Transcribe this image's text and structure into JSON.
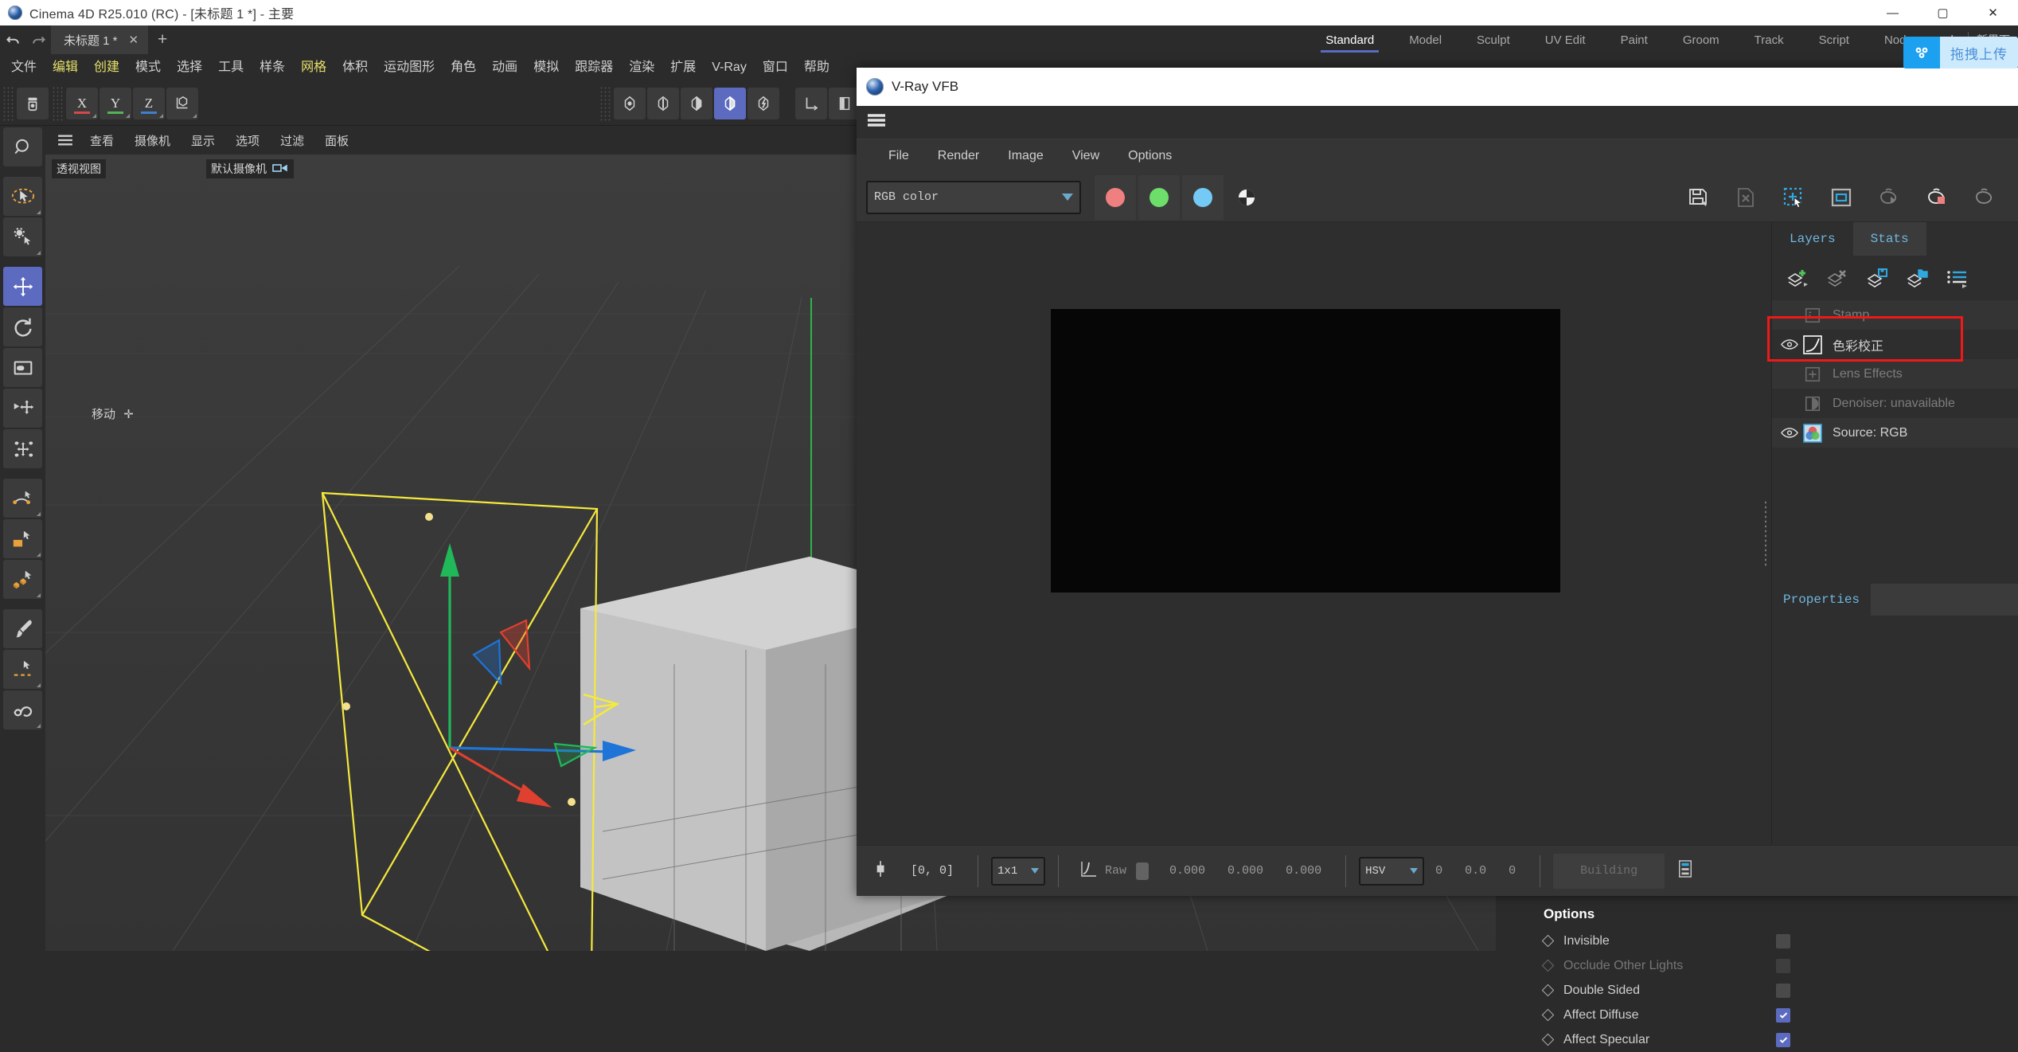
{
  "window": {
    "title": "Cinema 4D R25.010 (RC) - [未标题 1 *] - 主要",
    "app_icon": "cinema4d-logo-icon",
    "minimize_label": "—",
    "maximize_label": "▢",
    "close_label": "✕"
  },
  "tabrow": {
    "undo_icon": "undo-arrow-icon",
    "redo_icon": "redo-arrow-icon",
    "document_tab": "未标题 1 *",
    "document_tab_close": "✕",
    "add_tab": "+",
    "layout_tabs": [
      {
        "label": "Standard",
        "active": true
      },
      {
        "label": "Model",
        "active": false
      },
      {
        "label": "Sculpt",
        "active": false
      },
      {
        "label": "UV Edit",
        "active": false
      },
      {
        "label": "Paint",
        "active": false
      },
      {
        "label": "Groom",
        "active": false
      },
      {
        "label": "Track",
        "active": false
      },
      {
        "label": "Script",
        "active": false
      },
      {
        "label": "Nodes",
        "active": false
      }
    ],
    "layout_add": "+",
    "layout_right_label": "新界面"
  },
  "upload_badge": {
    "icon": "baidu-netdisk-icon",
    "label": "拖拽上传"
  },
  "main_menu": [
    {
      "label": "文件",
      "highlight": false
    },
    {
      "label": "编辑",
      "highlight": true
    },
    {
      "label": "创建",
      "highlight": true
    },
    {
      "label": "模式",
      "highlight": false
    },
    {
      "label": "选择",
      "highlight": false
    },
    {
      "label": "工具",
      "highlight": false
    },
    {
      "label": "样条",
      "highlight": false
    },
    {
      "label": "网格",
      "highlight": true
    },
    {
      "label": "体积",
      "highlight": false
    },
    {
      "label": "运动图形",
      "highlight": false
    },
    {
      "label": "角色",
      "highlight": false
    },
    {
      "label": "动画",
      "highlight": false
    },
    {
      "label": "模拟",
      "highlight": false
    },
    {
      "label": "跟踪器",
      "highlight": false
    },
    {
      "label": "渲染",
      "highlight": false
    },
    {
      "label": "扩展",
      "highlight": false
    },
    {
      "label": "V-Ray",
      "highlight": false
    },
    {
      "label": "窗口",
      "highlight": false
    },
    {
      "label": "帮助",
      "highlight": false
    }
  ],
  "toolbar": {
    "live_selection": "live-selection-icon",
    "axis_x": "X",
    "axis_y": "Y",
    "axis_z": "Z",
    "axis_system": "world-axis-icon",
    "points_mode": "points-mode-icon",
    "edges_mode": "edges-mode-icon",
    "polygons_mode": "polygons-mode-icon",
    "model_mode": "model-mode-icon",
    "texture_mode": "texture-mode-icon",
    "workplane": "workplane-icon",
    "viewport_solo": "viewport-solo-icon",
    "snap": "magnet-snap-icon",
    "snap_settings": "snap-settings-icon"
  },
  "left_tools": [
    "magnifier-icon",
    "live-selection-cursor-icon",
    "tool-settings-icon",
    "move-tool-icon",
    "rotate-tool-icon",
    "scale-tool-icon",
    "transfer-tool-icon",
    "reset-psr-icon",
    "spline-pen-icon",
    "polygon-pen-icon",
    "poly-brush-icon",
    "brush-tool-icon",
    "sculpt-pen-icon",
    "sculpt-spline-icon"
  ],
  "viewport": {
    "hamburger": "viewport-menu-icon",
    "menus": [
      "查看",
      "摄像机",
      "显示",
      "选项",
      "过滤",
      "面板"
    ],
    "view_label": "透视视图",
    "camera_label": "默认摄像机",
    "camera_lock_icon": "camera-lock-icon",
    "mode_hint": "移动",
    "mode_hint_icon": "move-axis-icon"
  },
  "options_panel": {
    "title": "Options",
    "rows": [
      {
        "label": "Invisible",
        "dim": false,
        "checked": false
      },
      {
        "label": "Occlude Other Lights",
        "dim": true,
        "checked": false
      },
      {
        "label": "Double Sided",
        "dim": false,
        "checked": false
      },
      {
        "label": "Affect Diffuse",
        "dim": false,
        "checked": true
      },
      {
        "label": "Affect Specular",
        "dim": false,
        "checked": true
      }
    ]
  },
  "vfb": {
    "title": "V-Ray VFB",
    "title_icon": "vray-logo-icon",
    "hamburger_icon": "vfb-menu-icon",
    "menus": [
      "File",
      "Render",
      "Image",
      "View",
      "Options"
    ],
    "channel_select": "RGB color",
    "channel_caret": "▼",
    "color_buttons": [
      {
        "name": "red-channel-toggle",
        "color": "#f07f80"
      },
      {
        "name": "green-channel-toggle",
        "color": "#6ede6b"
      },
      {
        "name": "blue-channel-toggle",
        "color": "#74c9f5"
      }
    ],
    "mono_button": "monochrome-toggle-icon",
    "right_tools": [
      "save-image-icon",
      "clear-image-icon",
      "region-render-icon",
      "crop-region-icon",
      "resume-render-icon",
      "stop-render-icon",
      "start-render-icon"
    ],
    "layers_panel": {
      "tabs": [
        {
          "label": "Layers",
          "selected": false
        },
        {
          "label": "Stats",
          "selected": true
        }
      ],
      "toolbar_icons": [
        "add-layer-icon",
        "remove-layer-icon",
        "save-layers-icon",
        "load-layers-icon",
        "layer-presets-icon"
      ],
      "rows": [
        {
          "name": "Stamp",
          "visible": false,
          "dim": true,
          "thumb": "stamp-layer-icon"
        },
        {
          "name": "色彩校正",
          "visible": true,
          "dim": false,
          "thumb": "color-curve-icon",
          "highlighted": true
        },
        {
          "name": "Lens Effects",
          "visible": false,
          "dim": true,
          "thumb": "lens-effects-icon"
        },
        {
          "name": "Denoiser: unavailable",
          "visible": false,
          "dim": true,
          "thumb": "denoiser-icon"
        },
        {
          "name": "Source: RGB",
          "visible": true,
          "dim": false,
          "thumb": "rgb-source-icon"
        }
      ],
      "properties_label": "Properties"
    },
    "status": {
      "pixel_icon": "pixel-probe-icon",
      "coords": "[0, 0]",
      "zoom_level": "1x1",
      "zoom_caret": "▼",
      "curve_icon": "exposure-curve-icon",
      "raw_label": "Raw",
      "raw_swatch": "raw-color-swatch",
      "values": [
        "0.000",
        "0.000",
        "0.000"
      ],
      "color_mode": "HSV",
      "color_mode_caret": "▼",
      "hsv_values": [
        "0",
        "0.0",
        "0"
      ],
      "render_status": "Building",
      "history_icon": "render-history-icon"
    }
  }
}
